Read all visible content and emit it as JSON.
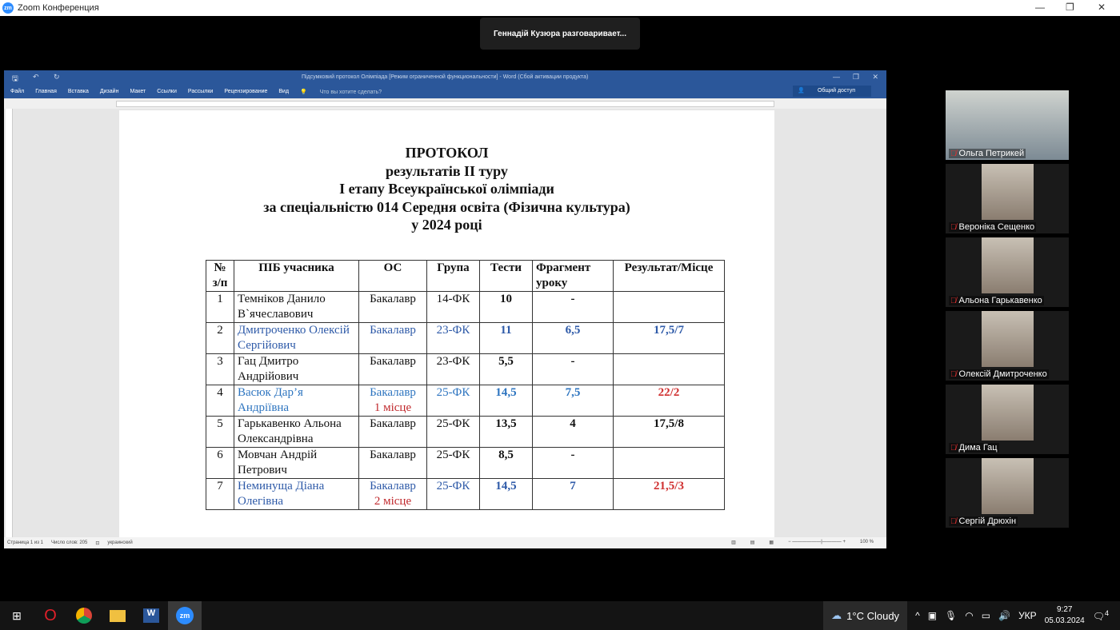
{
  "zoom": {
    "window_title": "Zoom Конференция",
    "speaker_toast": "Геннадій Кузюра разговаривает..."
  },
  "word": {
    "title": "Підсумковий протокол Олімпіада [Режим ограниченной функциональности] - Word (Сбой активации продукта)",
    "tabs": [
      "Файл",
      "Главная",
      "Вставка",
      "Дизайн",
      "Макет",
      "Ссылки",
      "Рассылки",
      "Рецензирование",
      "Вид"
    ],
    "tell_me": "Что вы хотите сделать?",
    "share": "Общий доступ",
    "status": {
      "page": "Страница 1 из 1",
      "words": "Число слов: 205",
      "language": "украинский",
      "zoom": "100 %"
    }
  },
  "document": {
    "title_lines": [
      "ПРОТОКОЛ",
      "результатів ІІ туру",
      "І етапу Всеукраїнської олімпіади",
      "за спеціальністю 014 Середня освіта (Фізична культура)",
      "у 2024 році"
    ],
    "headers": [
      "№ з/п",
      "ПІБ учасника",
      "ОС",
      "Група",
      "Тести",
      "Фрагмент уроку",
      "Результат/Місце"
    ],
    "rows": [
      {
        "n": "1",
        "name": "Темніков Данило В`ячеславович",
        "os": "Бакалавр",
        "place": "",
        "group": "14-ФК",
        "tests": "10",
        "fragment": "-",
        "result": ""
      },
      {
        "n": "2",
        "name": "Дмитроченко Олексій Сергійович",
        "os": "Бакалавр",
        "place": "",
        "group": "23-ФК",
        "tests": "11",
        "fragment": "6,5",
        "result": "17,5/7"
      },
      {
        "n": "3",
        "name": "Гац Дмитро Андрійович",
        "os": "Бакалавр",
        "place": "",
        "group": "23-ФК",
        "tests": "5,5",
        "fragment": "-",
        "result": ""
      },
      {
        "n": "4",
        "name": "Васюк Дар’я Андріївна",
        "os": "Бакалавр",
        "place": "1 місце",
        "group": "25-ФК",
        "tests": "14,5",
        "fragment": "7,5",
        "result": "22/2"
      },
      {
        "n": "5",
        "name": "Гарькавенко Альона Олександрівна",
        "os": "Бакалавр",
        "place": "",
        "group": "25-ФК",
        "tests": "13,5",
        "fragment": "4",
        "result": "17,5/8"
      },
      {
        "n": "6",
        "name": "Мовчан Андрій Петрович",
        "os": "Бакалавр",
        "place": "",
        "group": "25-ФК",
        "tests": "8,5",
        "fragment": "-",
        "result": ""
      },
      {
        "n": "7",
        "name": "Неминуща Діана Олегівна",
        "os": "Бакалавр",
        "place": "2 місце",
        "group": "25-ФК",
        "tests": "14,5",
        "fragment": "7",
        "result": "21,5/3"
      }
    ]
  },
  "participants": [
    "Ольга Петрикей",
    "Вероніка Сещенко",
    "Альона Гарькавенко",
    "Олексій Дмитроченко",
    "Дима Гац",
    "Сергій Дрюхін"
  ],
  "taskbar": {
    "weather": "1°C  Cloudy",
    "lang": "УКР",
    "time": "9:27",
    "date": "05.03.2024",
    "notifications": "4"
  }
}
